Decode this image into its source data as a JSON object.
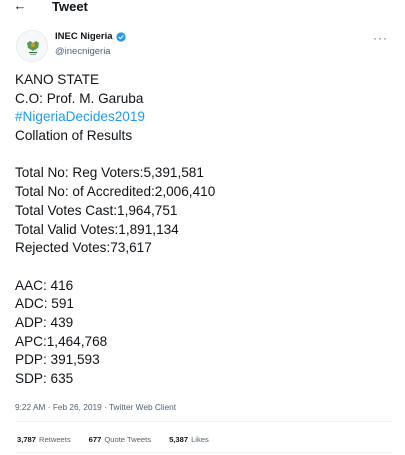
{
  "header": {
    "back_icon": "arrow-left-icon",
    "title": "Tweet"
  },
  "author": {
    "name": "INEC Nigeria",
    "handle": "@inecnigeria",
    "verified_color": "#1d9bf0",
    "more_icon": "more-horizontal-icon"
  },
  "tweet": {
    "lines": [
      "KANO STATE",
      "C.O: Prof. M. Garuba",
      "#NigeriaDecides2019",
      "Collation of Results",
      "",
      "Total No: Reg Voters:5,391,581",
      "Total No: of Accredited:2,006,410",
      "Total Votes Cast:1,964,751",
      "Total Valid Votes:1,891,134",
      "Rejected Votes:73,617",
      "",
      "AAC: 416",
      "ADC: 591",
      "ADP: 439",
      "APC:1,464,768",
      "PDP: 391,593",
      "SDP: 635"
    ],
    "hashtag_color": "#1d9bf0"
  },
  "meta": {
    "time_date_client": "9:22 AM · Feb 26, 2019 · Twitter Web Client"
  },
  "stats": {
    "retweets_count": "3,787",
    "retweets_label": "Retweets",
    "quotes_count": "677",
    "quotes_label": "Quote Tweets",
    "likes_count": "5,387",
    "likes_label": "Likes"
  }
}
